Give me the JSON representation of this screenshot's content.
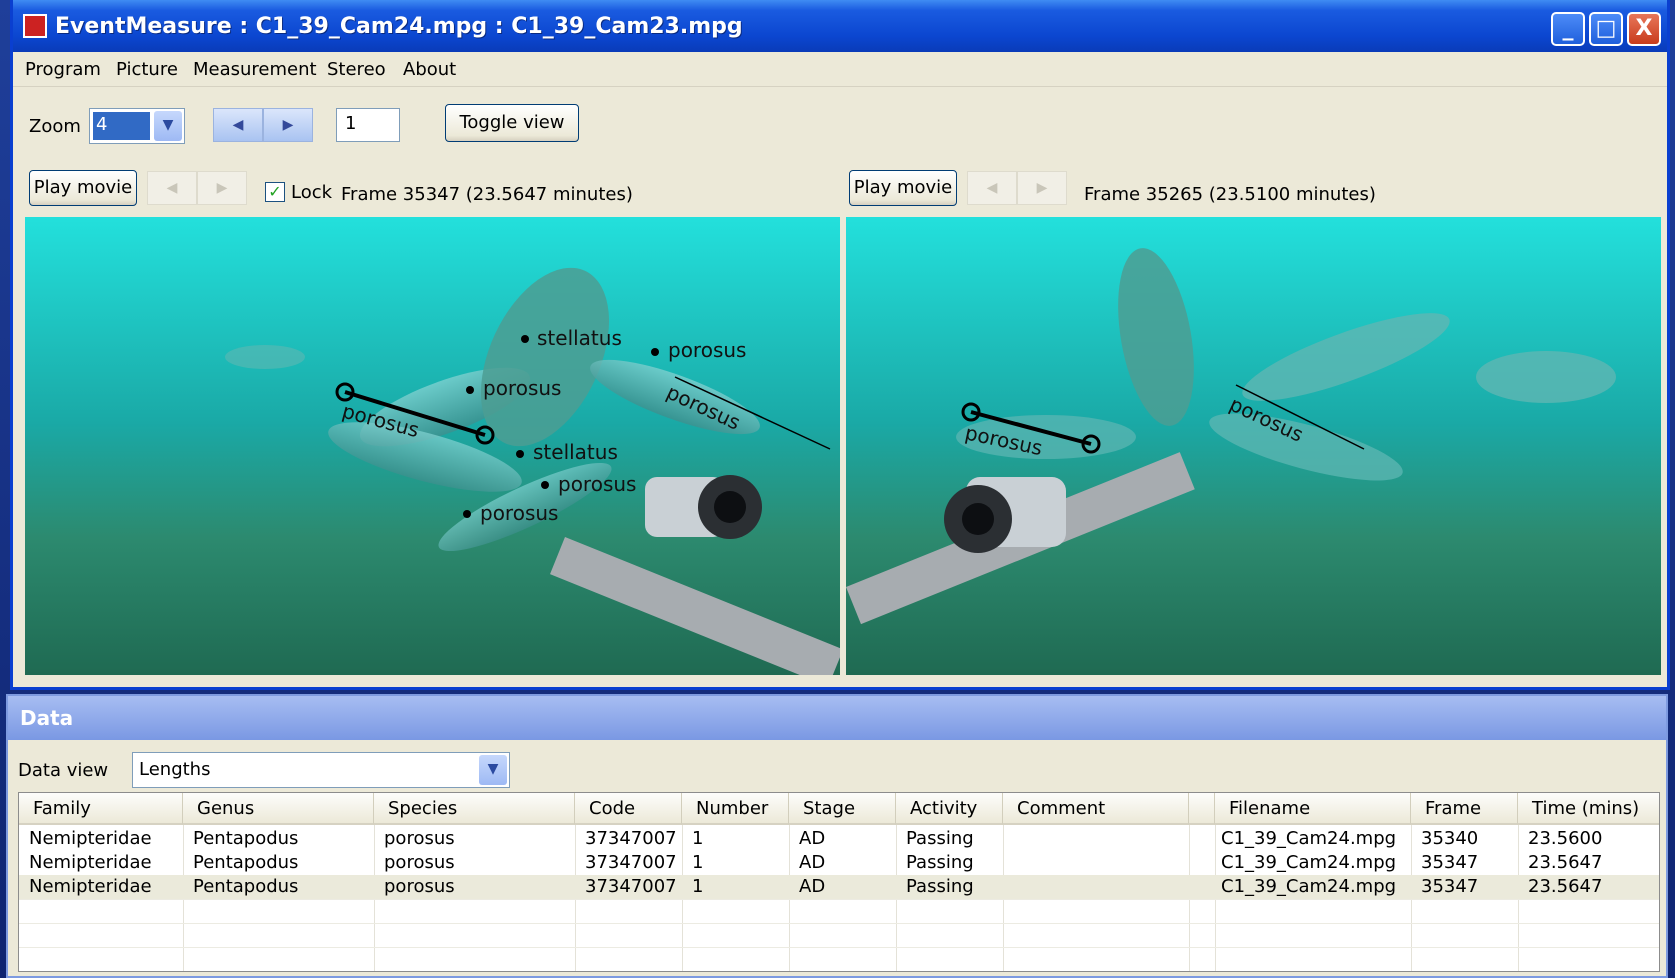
{
  "window": {
    "title": "EventMeasure : C1_39_Cam24.mpg : C1_39_Cam23.mpg",
    "buttons": {
      "minimize": "_",
      "maximize": "□",
      "close": "X"
    }
  },
  "menu": [
    "Program",
    "Picture",
    "Measurement",
    "Stereo",
    "About"
  ],
  "toolbar": {
    "zoom_label": "Zoom",
    "zoom_value": "4",
    "frame_step_value": "1",
    "toggle_label": "Toggle view"
  },
  "left_view": {
    "play_label": "Play movie",
    "lock_label": "Lock",
    "lock_checked": true,
    "frame_text": "Frame 35347 (23.5647 minutes)",
    "annotations": [
      "stellatus",
      "porosus",
      "porosus",
      "porosus",
      "porosus",
      "stellatus",
      "porosus",
      "porosus"
    ]
  },
  "right_view": {
    "play_label": "Play movie",
    "frame_text": "Frame 35265 (23.5100 minutes)",
    "annotations": [
      "porosus",
      "porosus"
    ]
  },
  "data_panel": {
    "title": "Data",
    "view_label": "Data view",
    "view_value": "Lengths",
    "columns": [
      "Family",
      "Genus",
      "Species",
      "Code",
      "Number",
      "Stage",
      "Activity",
      "Comment",
      "",
      "Filename",
      "Frame",
      "Time (mins)"
    ],
    "rows": [
      [
        "Nemipteridae",
        "Pentapodus",
        "porosus",
        "37347007",
        "1",
        "AD",
        "Passing",
        "",
        "",
        "C1_39_Cam24.mpg",
        "35340",
        "23.5600"
      ],
      [
        "Nemipteridae",
        "Pentapodus",
        "porosus",
        "37347007",
        "1",
        "AD",
        "Passing",
        "",
        "",
        "C1_39_Cam24.mpg",
        "35347",
        "23.5647"
      ],
      [
        "Nemipteridae",
        "Pentapodus",
        "porosus",
        "37347007",
        "1",
        "AD",
        "Passing",
        "",
        "",
        "C1_39_Cam24.mpg",
        "35347",
        "23.5647"
      ]
    ],
    "selected_row": 2
  },
  "icons": {
    "app": "app-icon",
    "dropdown": "chevron-down-icon",
    "prev": "chevron-left-icon",
    "next": "chevron-right-icon",
    "check": "checkmark-icon"
  },
  "colors": {
    "titlebar": "#0b46d0",
    "window_bg": "#ece9d8",
    "water": "#1fb8b0",
    "seabed": "#3a8a6a",
    "selection": "#316ac5"
  }
}
